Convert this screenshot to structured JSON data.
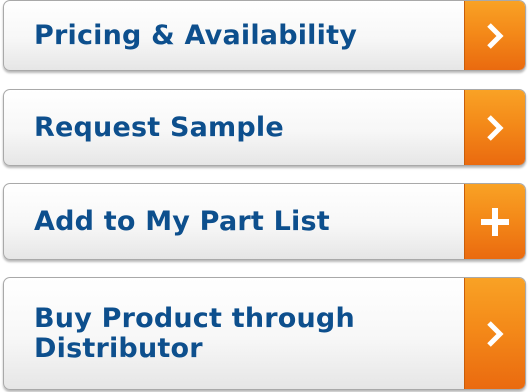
{
  "buttons": [
    {
      "label": "Pricing & Availability",
      "icon": "chevron-right-icon"
    },
    {
      "label": "Request Sample",
      "icon": "chevron-right-icon"
    },
    {
      "label": "Add to My Part List",
      "icon": "plus-icon"
    },
    {
      "label": "Buy Product through Distributor",
      "icon": "chevron-right-icon"
    }
  ],
  "colors": {
    "label_text": "#0d4f8d",
    "accent_orange": "#f48a19",
    "button_border": "#a9a9a9"
  }
}
